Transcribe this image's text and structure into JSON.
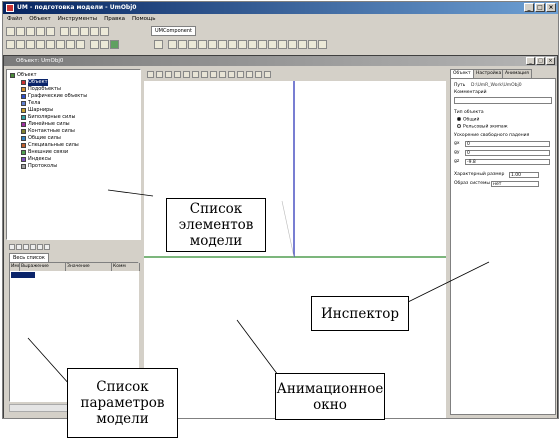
{
  "window": {
    "title": "UM - подготовка модели - UmObj0",
    "btn_min": "_",
    "btn_max": "□",
    "btn_close": "×"
  },
  "menu": [
    "Файл",
    "Объект",
    "Инструменты",
    "Правка",
    "Помощь"
  ],
  "component_tab": "UMComponent",
  "object_window": {
    "title": "Объект: UmObj0"
  },
  "tree": [
    {
      "label": "Объект",
      "level": 0,
      "color": "#4a8a3a"
    },
    {
      "label": "Объект",
      "level": 1,
      "color": "#c83030"
    },
    {
      "label": "Подобъекты",
      "level": 1,
      "color": "#d09030"
    },
    {
      "label": "Графические объекты",
      "level": 1,
      "color": "#3050c8"
    },
    {
      "label": "Тела",
      "level": 1,
      "color": "#6080d0"
    },
    {
      "label": "Шарниры",
      "level": 1,
      "color": "#c8a030"
    },
    {
      "label": "Биполярные силы",
      "level": 1,
      "color": "#30a0a0"
    },
    {
      "label": "Линейные силы",
      "level": 1,
      "color": "#a030a0"
    },
    {
      "label": "Контактные силы",
      "level": 1,
      "color": "#808030"
    },
    {
      "label": "Общие силы",
      "level": 1,
      "color": "#3080c0"
    },
    {
      "label": "Специальные силы",
      "level": 1,
      "color": "#c06030"
    },
    {
      "label": "Внешние связи",
      "level": 1,
      "color": "#50a050"
    },
    {
      "label": "Индексы",
      "level": 1,
      "color": "#8050c0"
    },
    {
      "label": "Протоколы",
      "level": 1,
      "color": "#a0a0a0"
    }
  ],
  "params": {
    "tab": "Весь список",
    "columns": [
      "Имя",
      "Выражение",
      "Значение",
      "Комм"
    ]
  },
  "inspector": {
    "tabs": [
      "Объект",
      "Настройка",
      "Анимация"
    ],
    "path_label": "Путь",
    "path_value": "D:\\UmR_Work\\UmObj0",
    "comment_label": "Комментарий",
    "object_type_label": "Тип объекта",
    "radio_general": "Общий",
    "radio_rail": "Рельсовый экипаж",
    "gravity_label": "Ускорение свободного падения",
    "gx_label": "gx",
    "gx_value": "0",
    "gy_label": "gy",
    "gy_value": "0",
    "gz_label": "gz",
    "gz_value": "-9.8",
    "char_size_label": "Характерный размер",
    "char_size_value": "1.00",
    "coord_label": "Образ системы",
    "coord_value": "нет"
  },
  "labels": {
    "elements": "Список элементов модели",
    "inspector": "Инспектор",
    "params": "Список параметров модели",
    "anim": "Анимационное окно"
  }
}
